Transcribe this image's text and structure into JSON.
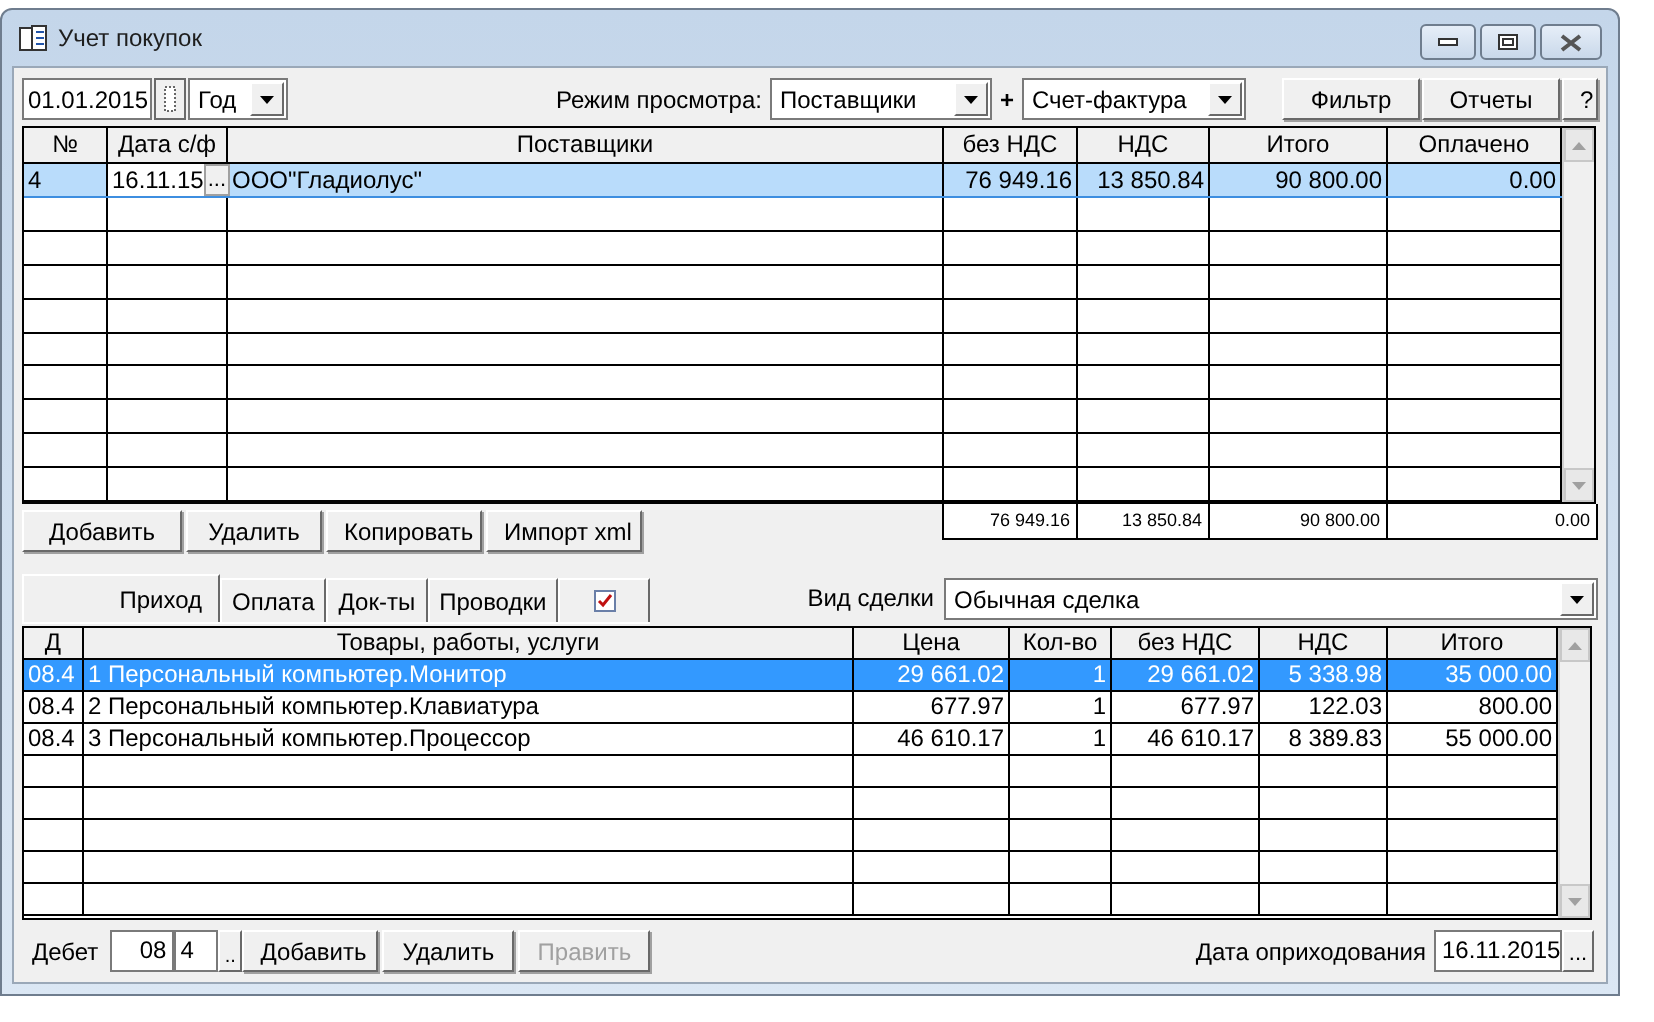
{
  "window": {
    "title": "Учет покупок"
  },
  "toolbar": {
    "date": "01.01.2015",
    "period": "Год",
    "view_mode_label": "Режим просмотра:",
    "view_mode": "Поставщики",
    "plus": "+",
    "doc_type": "Счет-фактура",
    "buttons": [
      "Фильтр",
      "Отчеты",
      "?"
    ]
  },
  "invoices": {
    "columns": [
      "№",
      "Дата с/ф",
      "Поставщики",
      "без НДС",
      "НДС",
      "Итого",
      "Оплачено"
    ],
    "rows": [
      {
        "number": "4",
        "date": "16.11.15",
        "date_button": "...",
        "supplier": "ООО\"Гладиолус\"",
        "net": "76 949.16",
        "vat": "13 850.84",
        "total": "90 800.00",
        "paid": "0.00",
        "selected": true
      }
    ],
    "totals": [
      "76 949.16",
      "13 850.84",
      "90 800.00",
      "0.00"
    ]
  },
  "invoice_buttons": [
    "Добавить",
    "Удалить",
    "Копировать",
    "Импорт xml"
  ],
  "tabs": [
    {
      "kind": "text",
      "label": "Приход",
      "selected": true
    },
    {
      "kind": "text",
      "label": "Оплата",
      "selected": false
    },
    {
      "kind": "text",
      "label": "Док-ты",
      "selected": false
    },
    {
      "kind": "text",
      "label": "Проводки",
      "selected": false
    },
    {
      "kind": "checkbox",
      "checked": true,
      "selected": false
    }
  ],
  "deal_type": {
    "label": "Вид сделки",
    "value": "Обычная сделка"
  },
  "items": {
    "columns": [
      "Д",
      "Товары, работы, услуги",
      "Цена",
      "Кол-во",
      "без НДС",
      "НДС",
      "Итого"
    ],
    "rows": [
      {
        "cells": [
          "08.4",
          "1 Персональный компьютер.Монитор",
          "29 661.02",
          "1",
          "29 661.02",
          "5 338.98",
          "35 000.00"
        ],
        "selected": true
      },
      {
        "cells": [
          "08.4",
          "2 Персональный компьютер.Клавиатура",
          "677.97",
          "1",
          "677.97",
          "122.03",
          "800.00"
        ],
        "selected": false
      },
      {
        "cells": [
          "08.4",
          "3 Персональный компьютер.Процессор",
          "46 610.17",
          "1",
          "46 610.17",
          "8 389.83",
          "55 000.00"
        ],
        "selected": false
      }
    ]
  },
  "footer": {
    "debit_label": "Дебет",
    "account": "08",
    "subaccount": "4",
    "picker": "..",
    "buttons": [
      {
        "label": "Добавить",
        "disabled": false
      },
      {
        "label": "Удалить",
        "disabled": false
      },
      {
        "label": "Править",
        "disabled": true
      }
    ],
    "date_label": "Дата оприходования",
    "date": "16.11.2015",
    "date_picker": "..."
  }
}
